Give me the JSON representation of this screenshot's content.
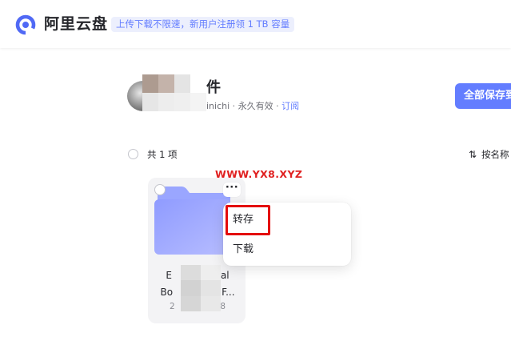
{
  "app": {
    "brand": "阿里云盘",
    "promo": "上传下载不限速，新用户注册领 1 TB 容量"
  },
  "share": {
    "title": "件",
    "meta_prefix": "inichi · 永久有效 · ",
    "subscribe": "订阅",
    "save_all": "全部保存到"
  },
  "list": {
    "count": "共 1 项",
    "sort": "按名称"
  },
  "watermark": "WWW.YX8.XYZ",
  "file": {
    "name_line1": "E                al",
    "name_line2": "Bo                F...",
    "date": "2                 8",
    "more": "···"
  },
  "menu": {
    "save": "转存",
    "download": "下载"
  },
  "colors": {
    "accent": "#637dff",
    "highlight": "#e40b0b",
    "watermark": "#e02020"
  },
  "icons": {
    "logo": "aliyun-drive-logo",
    "folder": "folder-icon",
    "sort": "sort-arrows-icon",
    "more": "more-dots-icon"
  }
}
